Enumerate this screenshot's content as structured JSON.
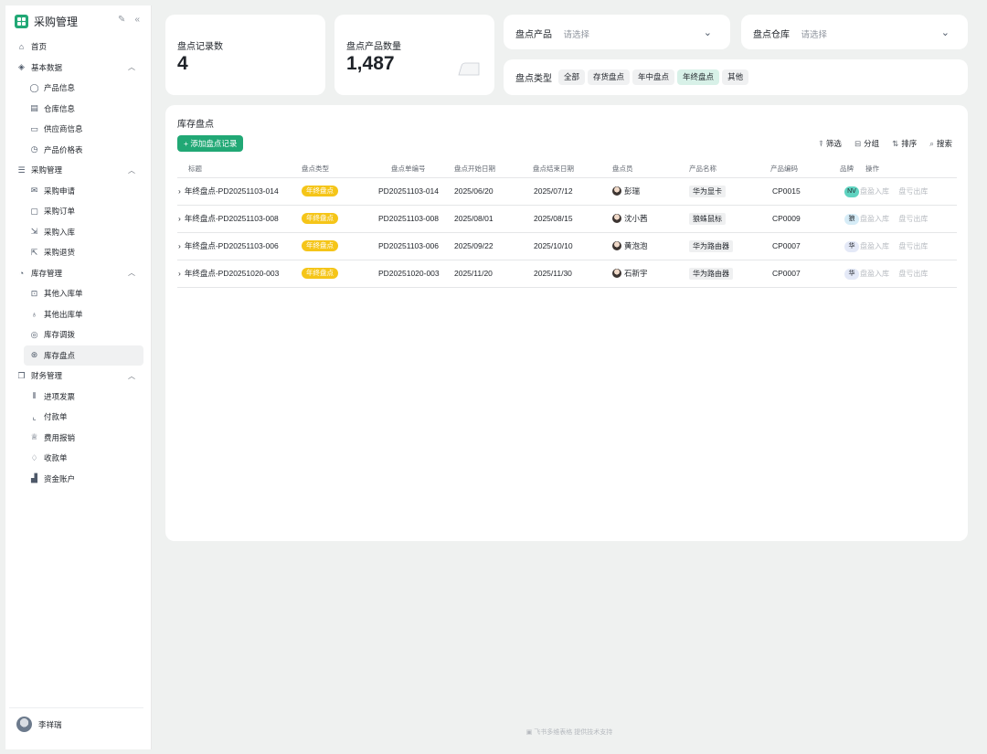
{
  "app": {
    "title": "采购管理"
  },
  "sidebar": {
    "items": [
      {
        "label": "首页",
        "icon": "home-icon"
      },
      {
        "label": "基本数据",
        "icon": "layers-icon"
      },
      {
        "label": "产品信息",
        "icon": "globe-icon"
      },
      {
        "label": "仓库信息",
        "icon": "warehouse-icon"
      },
      {
        "label": "供应商信息",
        "icon": "laptop-icon"
      },
      {
        "label": "产品价格表",
        "icon": "price-tag-icon"
      },
      {
        "label": "采购管理",
        "icon": "list-icon"
      },
      {
        "label": "采购申请",
        "icon": "mail-icon"
      },
      {
        "label": "采购订单",
        "icon": "calendar-icon"
      },
      {
        "label": "采购入库",
        "icon": "inbox-icon"
      },
      {
        "label": "采购退货",
        "icon": "return-icon"
      },
      {
        "label": "库存管理",
        "icon": "pie-chart-icon"
      },
      {
        "label": "其他入库单",
        "icon": "stock-in-icon"
      },
      {
        "label": "其他出库单",
        "icon": "stock-out-icon"
      },
      {
        "label": "库存调拨",
        "icon": "transfer-icon"
      },
      {
        "label": "库存盘点",
        "icon": "inventory-check-icon"
      },
      {
        "label": "财务管理",
        "icon": "copy-icon"
      },
      {
        "label": "进项发票",
        "icon": "barcode-icon"
      },
      {
        "label": "付款单",
        "icon": "chart-line-icon"
      },
      {
        "label": "费用报销",
        "icon": "trophy-icon"
      },
      {
        "label": "收款单",
        "icon": "bulb-icon"
      },
      {
        "label": "资金账户",
        "icon": "bar-chart-icon"
      }
    ],
    "user": {
      "name": "李祥瑞"
    }
  },
  "stats": {
    "records": {
      "label": "盘点记录数",
      "value": "4"
    },
    "quantity": {
      "label": "盘点产品数量",
      "value": "1,487"
    }
  },
  "filters": {
    "product": {
      "label": "盘点产品",
      "placeholder": "请选择"
    },
    "warehouse": {
      "label": "盘点仓库",
      "placeholder": "请选择"
    },
    "type": {
      "label": "盘点类型",
      "options": [
        "全部",
        "存货盘点",
        "年中盘点",
        "年终盘点",
        "其他"
      ],
      "selected": "年终盘点"
    }
  },
  "panel": {
    "title": "库存盘点",
    "add_label": "添加盘点记录",
    "toolbar": {
      "filter": "筛选",
      "group": "分组",
      "sort": "排序",
      "search": "搜索"
    }
  },
  "table": {
    "columns": [
      "标题",
      "盘点类型",
      "盘点单编号",
      "盘点开始日期",
      "盘点结束日期",
      "盘点员",
      "产品名称",
      "产品编码",
      "品牌",
      "操作"
    ],
    "rows": [
      {
        "title": "年终盘点-PD20251103-014",
        "type": "年终盘点",
        "code": "PD20251103-014",
        "start": "2025/06/20",
        "end": "2025/07/12",
        "auditor": "彭瑞",
        "product": "华为显卡",
        "product_code": "CP0015",
        "brand": "NV",
        "brand_color": "#5fd3c0"
      },
      {
        "title": "年终盘点-PD20251103-008",
        "type": "年终盘点",
        "code": "PD20251103-008",
        "start": "2025/08/01",
        "end": "2025/08/15",
        "auditor": "沈小茜",
        "product": "狼蛛鼠标",
        "product_code": "CP0009",
        "brand": "狼",
        "brand_color": "#d6ecf7"
      },
      {
        "title": "年终盘点-PD20251103-006",
        "type": "年终盘点",
        "code": "PD20251103-006",
        "start": "2025/09/22",
        "end": "2025/10/10",
        "auditor": "黄泡泡",
        "product": "华为路由器",
        "product_code": "CP0007",
        "brand": "华",
        "brand_color": "#e4e9f7"
      },
      {
        "title": "年终盘点-PD20251020-003",
        "type": "年终盘点",
        "code": "PD20251020-003",
        "start": "2025/11/20",
        "end": "2025/11/30",
        "auditor": "石新宇",
        "product": "华为路由器",
        "product_code": "CP0007",
        "brand": "华",
        "brand_color": "#e4e9f7"
      }
    ],
    "actions": {
      "stock_in": "盘盈入库",
      "stock_out": "盘亏出库"
    }
  },
  "footer": {
    "text": "飞书多维表格 提供技术支持"
  },
  "colors": {
    "accent": "#21a875",
    "tag_yellow": "#f5c518",
    "selected_chip": "#d8f1e8"
  }
}
